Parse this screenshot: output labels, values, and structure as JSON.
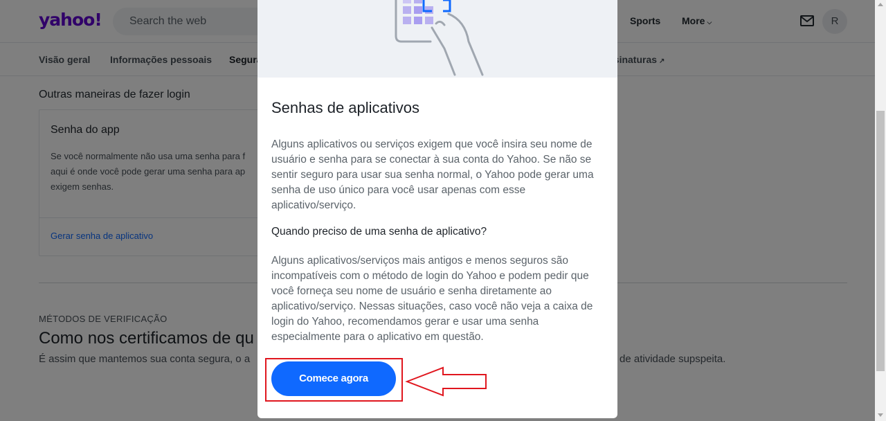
{
  "header": {
    "logo": "yahoo!",
    "search_placeholder": "Search the web",
    "nav": {
      "sports": "Sports",
      "more": "More"
    },
    "avatar_initial": "R"
  },
  "subnav": {
    "items": [
      "Visão geral",
      "Informações pessoais",
      "Segura",
      "ssinaturas"
    ]
  },
  "background": {
    "other_ways_label": "Outras maneiras de fazer login",
    "card_title": "Senha do app",
    "card_desc_lines": [
      "Se você normalmente não usa uma senha para f",
      "aqui é onde você pode gerar uma senha para ap",
      "exigem senhas."
    ],
    "card_link": "Gerar senha de aplicativo",
    "verification_label": "MÉTODOS DE VERIFICAÇÃO",
    "verification_title": "Como nos certificamos de qu",
    "verification_text": "É assim que mantemos sua conta segura, o a",
    "verification_text_right": "de atividade supspeita."
  },
  "modal": {
    "title": "Senhas de aplicativos",
    "paragraph1": "Alguns aplicativos ou serviços exigem que você insira seu nome de usuário e senha para se conectar à sua conta do Yahoo. Se não se sentir seguro para usar sua senha normal, o Yahoo pode gerar uma senha de uso único para você usar apenas com esse aplicativo/serviço.",
    "question": "Quando preciso de uma senha de aplicativo?",
    "paragraph2": "Alguns aplicativos/serviços mais antigos e menos seguros são incompatíveis com o método de login do  Yahoo e podem pedir que você forneça seu nome de usuário e senha diretamente ao aplicativo/serviço. Nessas situações, caso você não veja a caixa de login do Yahoo, recomendamos gerar e usar uma senha especialmente para o aplicativo em questão.",
    "cta_label": "Comece agora"
  },
  "colors": {
    "brand": "#6001d2",
    "primary_button": "#0f69ff",
    "annotation": "#e0161e"
  }
}
